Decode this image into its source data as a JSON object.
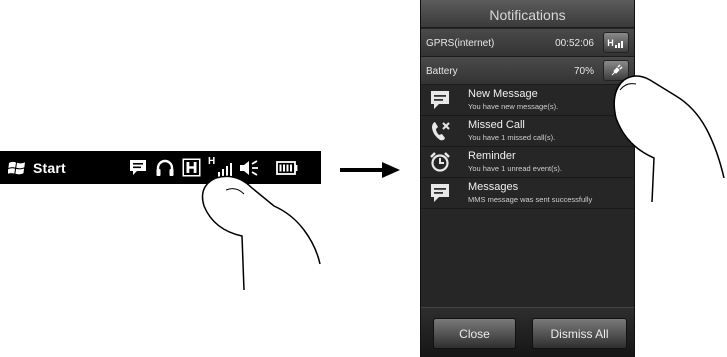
{
  "taskbar": {
    "start_label": "Start",
    "start_icon": "windows-flag-icon",
    "icons": [
      "message-icon",
      "headset-icon",
      "hsdpa-h-icon",
      "signal-icon",
      "volume-icon",
      "battery-icon"
    ],
    "h_label": "H",
    "signal_label": "H"
  },
  "phone": {
    "title": "Notifications",
    "gprs": {
      "label": "GPRS(internet)",
      "time": "00:52:06",
      "btn_label": "H"
    },
    "battery": {
      "label": "Battery",
      "value": "70%"
    },
    "notifications": [
      {
        "title": "New Message",
        "subtitle": "You have new message(s).",
        "icon": "message-icon"
      },
      {
        "title": "Missed Call",
        "subtitle": "You have 1 missed call(s).",
        "icon": "missed-call-icon"
      },
      {
        "title": "Reminder",
        "subtitle": "You have 1 unread event(s).",
        "icon": "alarm-clock-icon"
      },
      {
        "title": "Messages",
        "subtitle": "MMS message was sent successfully",
        "icon": "mms-icon"
      }
    ],
    "buttons": {
      "close": "Close",
      "dismiss_all": "Dismiss All"
    }
  },
  "colors": {
    "taskbar_bg": "#000000",
    "phone_bg": "#262626",
    "text": "#f0f0f0"
  }
}
